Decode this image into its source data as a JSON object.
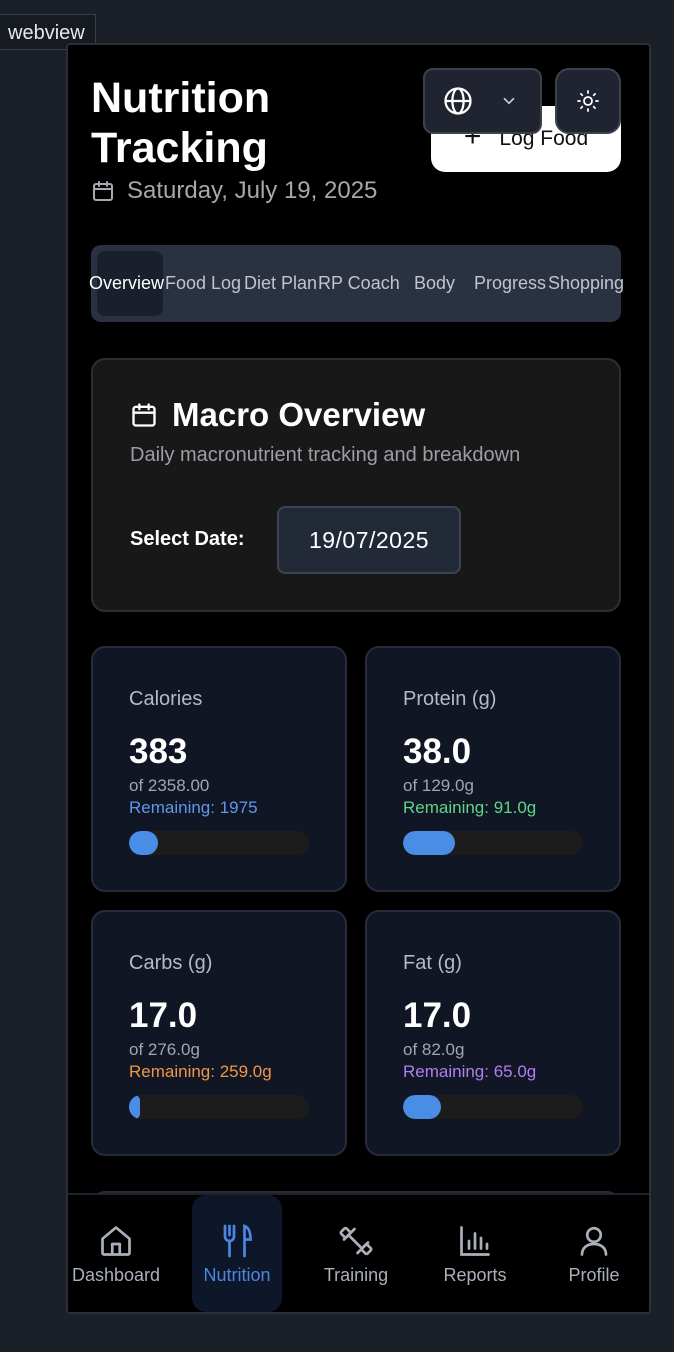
{
  "webview_label": "webview",
  "header": {
    "title": "Nutrition Tracking",
    "date": "Saturday, July 19, 2025",
    "log_food": "Log Food"
  },
  "tabs": [
    "Overview",
    "Food Log",
    "Diet Plan",
    "RP Coach",
    "Body",
    "Progress",
    "Shopping"
  ],
  "active_tab": "Overview",
  "macro_overview": {
    "title": "Macro Overview",
    "subtitle": "Daily macronutrient tracking and breakdown",
    "select_date_label": "Select Date:",
    "date_value": "19/07/2025"
  },
  "stats": [
    {
      "label": "Calories",
      "value": "383",
      "of": "of 2358.00",
      "remaining": "Remaining: 1975",
      "progress": 0.16,
      "remaining_color": "#5f97ec"
    },
    {
      "label": "Protein (g)",
      "value": "38.0",
      "of": "of 129.0g",
      "remaining": "Remaining: 91.0g",
      "progress": 0.29,
      "remaining_color": "#5ed58a"
    },
    {
      "label": "Carbs (g)",
      "value": "17.0",
      "of": "of 276.0g",
      "remaining": "Remaining: 259.0g",
      "progress": 0.06,
      "remaining_color": "#f0964a"
    },
    {
      "label": "Fat (g)",
      "value": "17.0",
      "of": "of 82.0g",
      "remaining": "Remaining: 65.0g",
      "progress": 0.21,
      "remaining_color": "#b27ef0"
    }
  ],
  "bottom_nav": [
    {
      "label": "Dashboard",
      "icon": "home-icon"
    },
    {
      "label": "Nutrition",
      "icon": "utensils-icon"
    },
    {
      "label": "Training",
      "icon": "dumbbell-icon"
    },
    {
      "label": "Reports",
      "icon": "bar-chart-icon"
    },
    {
      "label": "Profile",
      "icon": "user-icon"
    }
  ],
  "active_nav": "Nutrition",
  "colors": {
    "accent": "#4a8de6",
    "progress_fill": "#4a8de6"
  }
}
